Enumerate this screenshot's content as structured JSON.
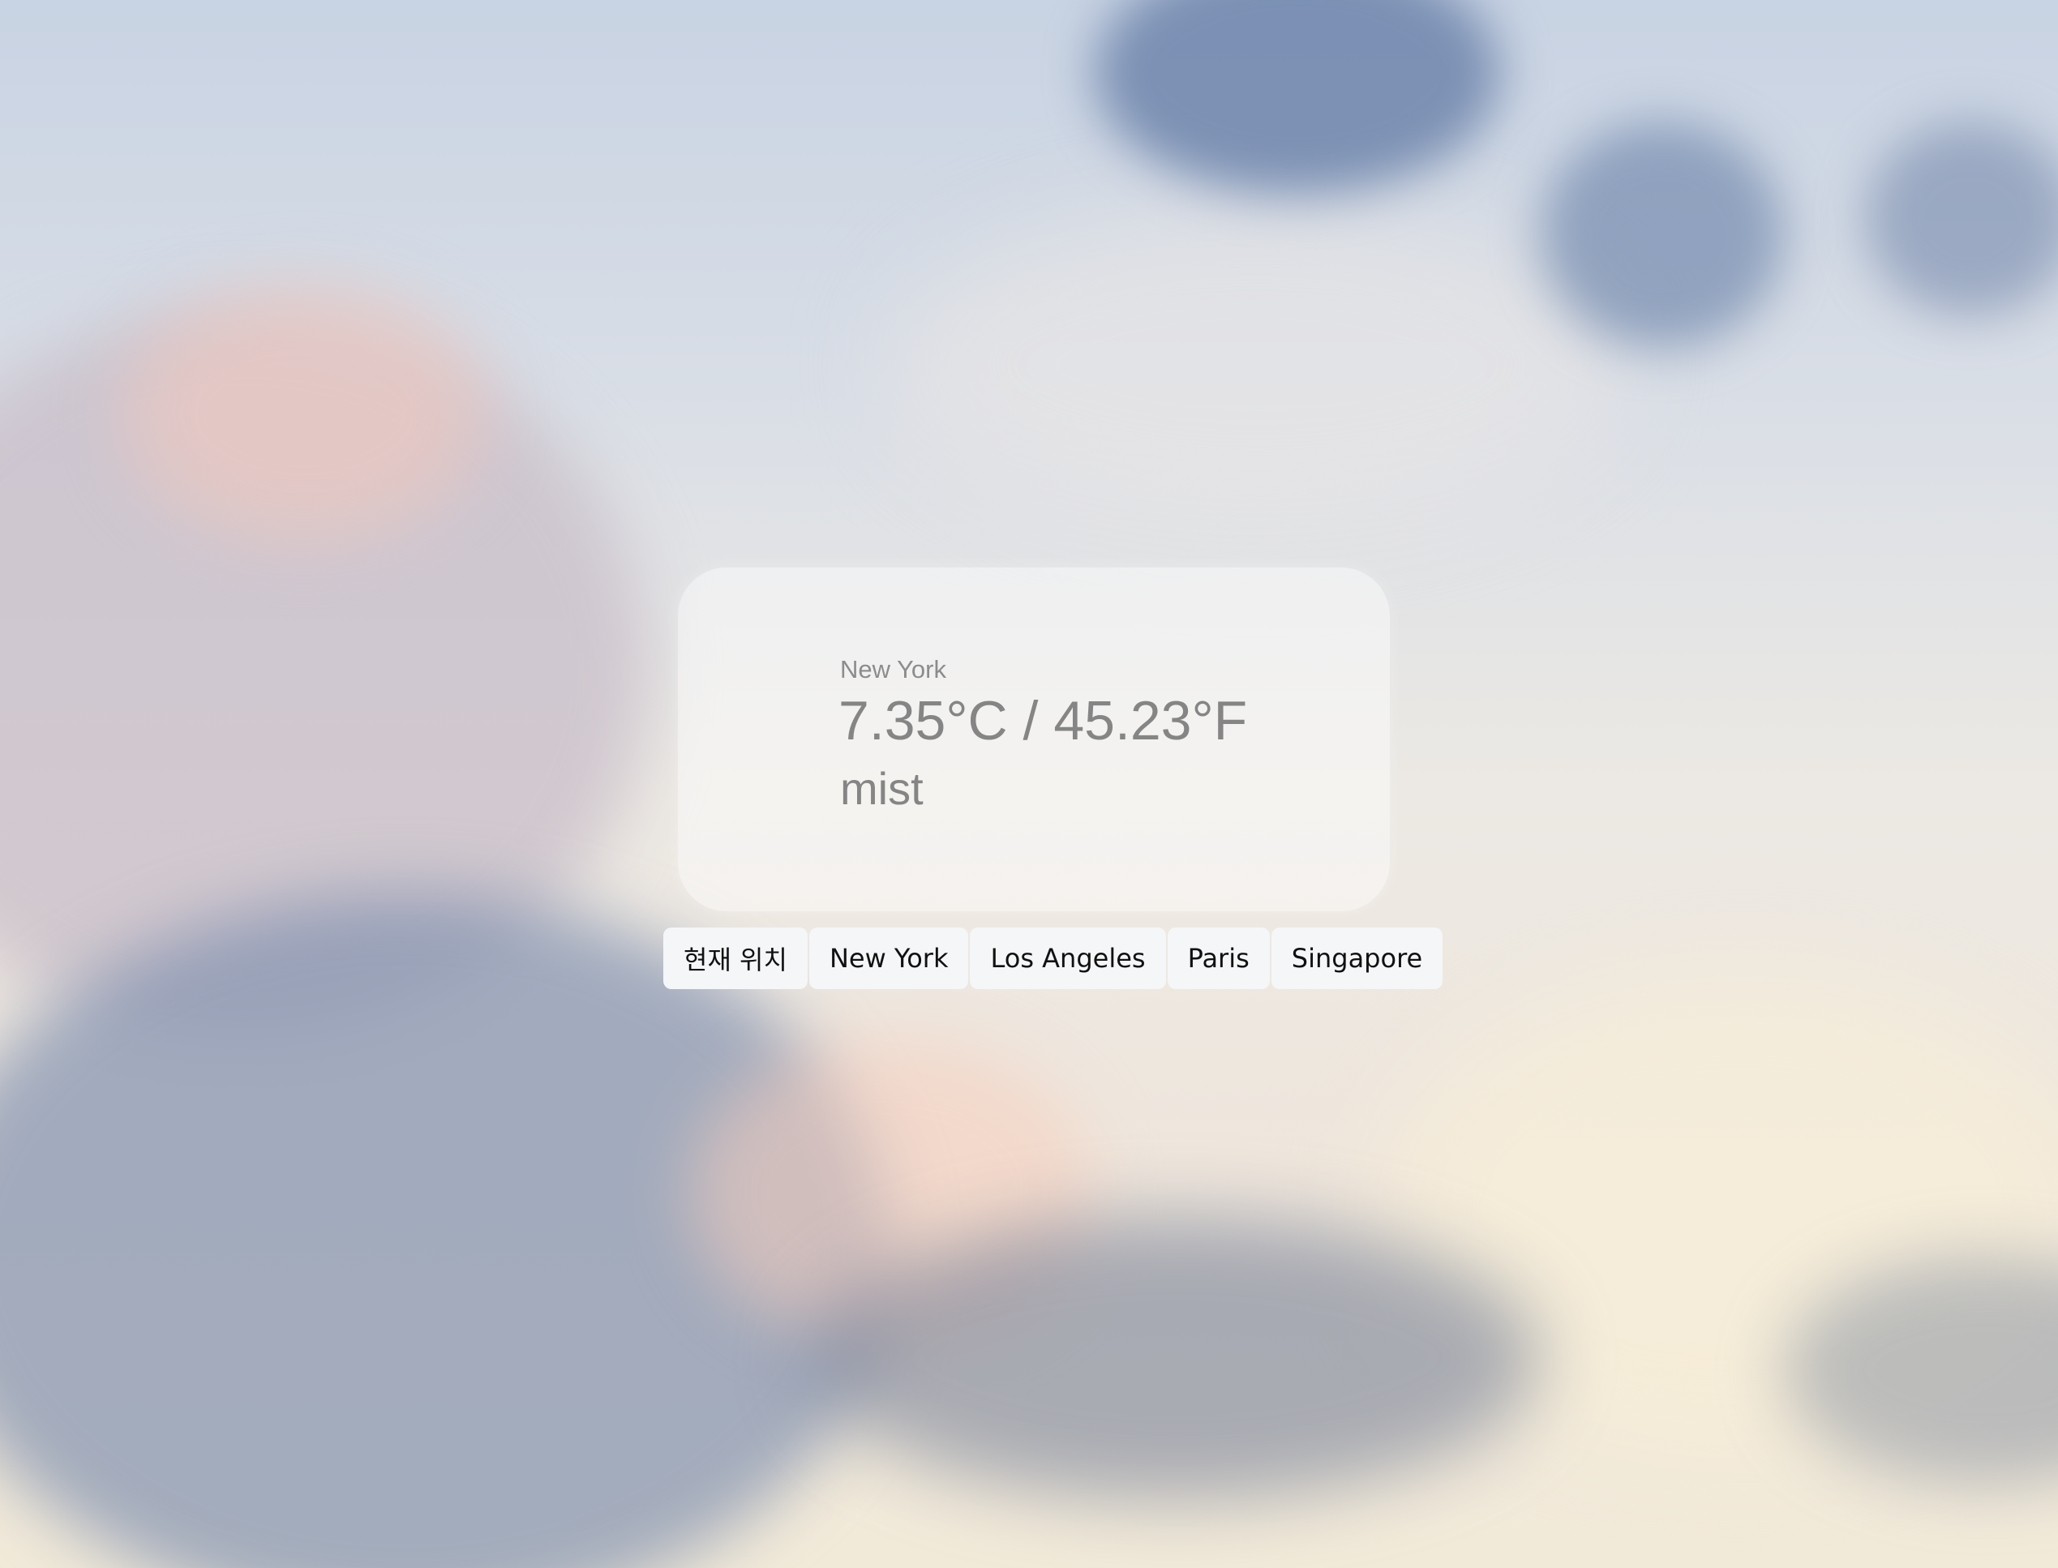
{
  "weather": {
    "city": "New York",
    "temperature": "7.35°C / 45.23°F",
    "description": "mist"
  },
  "location_buttons": [
    "현재 위치",
    "New York",
    "Los Angeles",
    "Paris",
    "Singapore"
  ]
}
